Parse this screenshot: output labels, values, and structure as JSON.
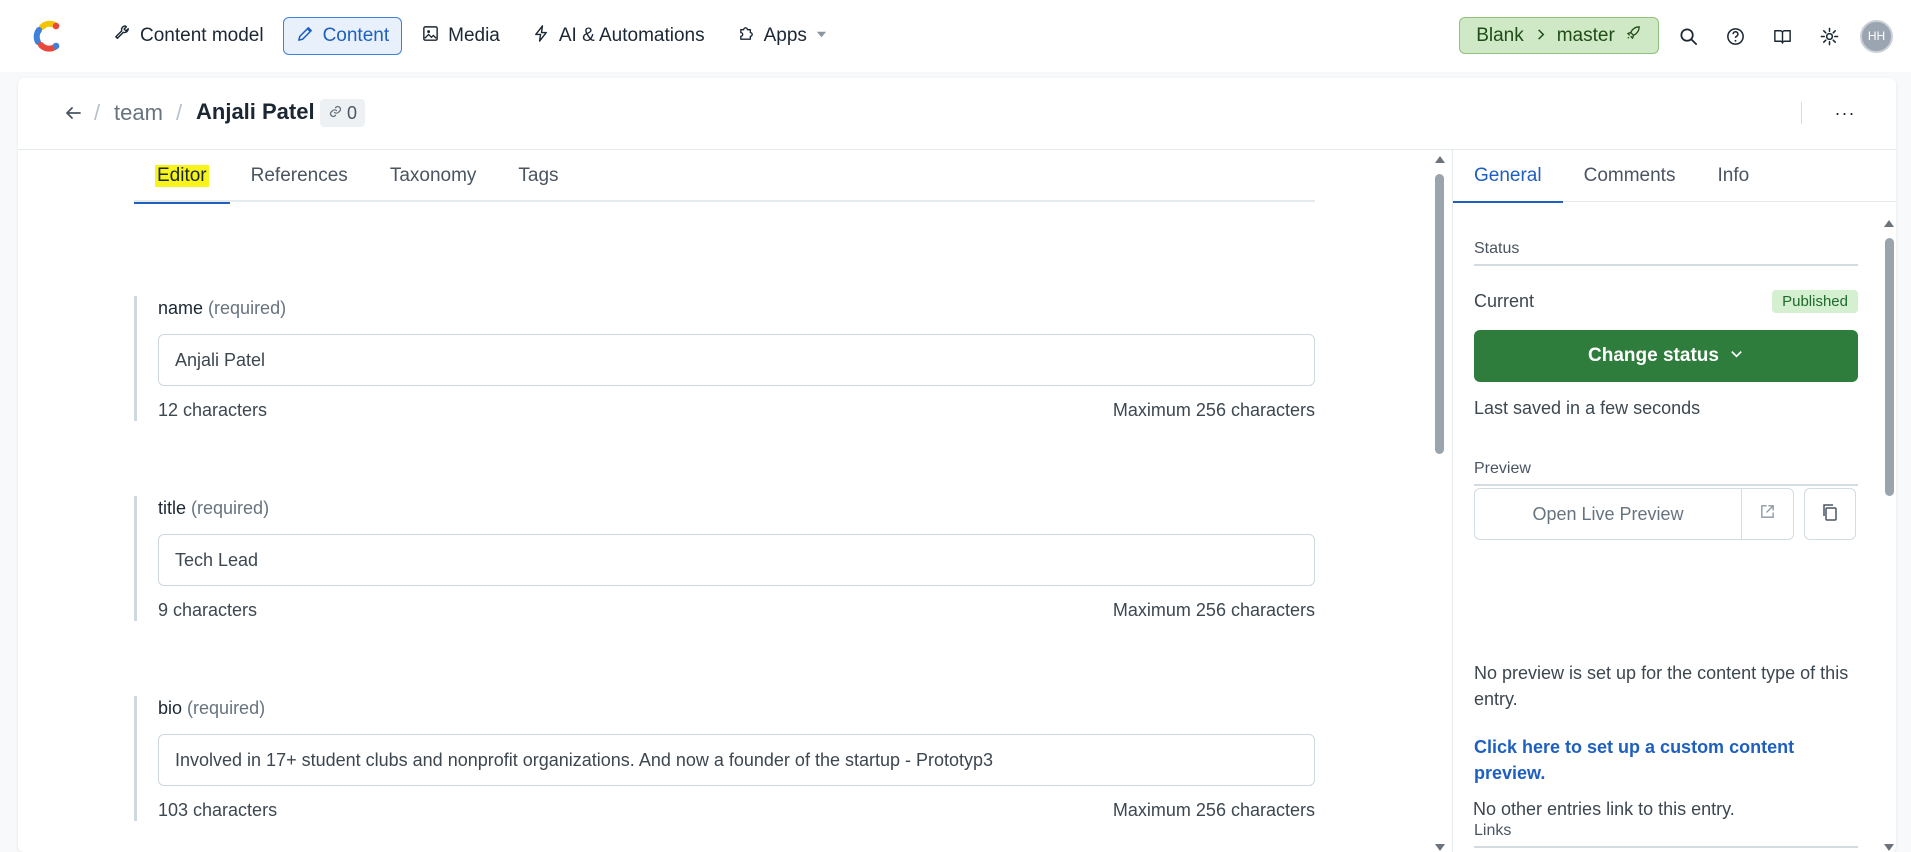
{
  "topnav": {
    "logo": "contentful-logo-icon",
    "items": [
      {
        "label": "Content model",
        "icon": "wrench-icon"
      },
      {
        "label": "Content",
        "icon": "pen-icon",
        "active": true
      },
      {
        "label": "Media",
        "icon": "image-icon"
      },
      {
        "label": "AI & Automations",
        "icon": "lightning-icon"
      },
      {
        "label": "Apps",
        "icon": "puzzle-icon"
      }
    ],
    "space": "Blank",
    "environment": "master",
    "avatar_initials": "HH",
    "env_color": "#cfe8c6"
  },
  "entry": {
    "breadcrumb_parent": "team",
    "title": "Anjali Patel",
    "references_count": "0"
  },
  "editor": {
    "tabs": [
      "Editor",
      "References",
      "Taxonomy",
      "Tags"
    ],
    "required_text": "(required)",
    "fields": [
      {
        "name": "name",
        "value": "Anjali Patel",
        "count": "12 characters",
        "max": "Maximum 256 characters"
      },
      {
        "name": "title",
        "value": "Tech Lead",
        "count": "9 characters",
        "max": "Maximum 256 characters"
      },
      {
        "name": "bio",
        "value": "Involved in 17+ student clubs and nonprofit organizations. And now a founder of the startup - Prototyp3",
        "count": "103 characters",
        "max": "Maximum 256 characters"
      }
    ]
  },
  "sidebar": {
    "tabs": [
      "General",
      "Comments",
      "Info"
    ],
    "status_heading": "Status",
    "current_label": "Current",
    "status_badge": "Published",
    "change_status": "Change status",
    "last_saved": "Last saved in a few seconds",
    "preview_heading": "Preview",
    "open_live_preview": "Open Live Preview",
    "no_preview_text": "No preview is set up for the content type of this entry.",
    "setup_link": "Click here to set up a custom content preview.",
    "links_heading": "Links",
    "no_links_text": "No other entries link to this entry.",
    "accent_color": "#2e7d3c",
    "link_color": "#1e5fbf"
  }
}
